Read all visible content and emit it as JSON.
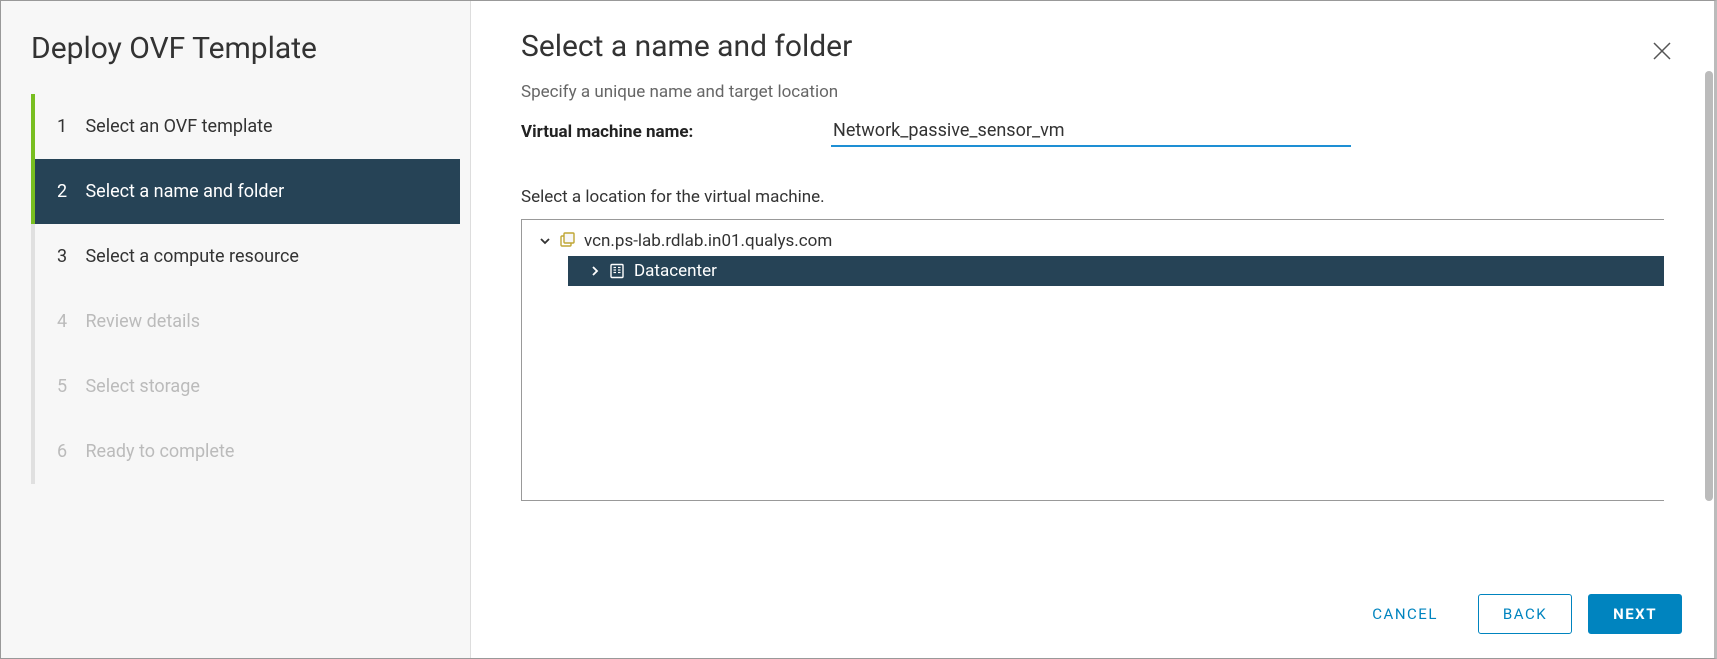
{
  "sidebar": {
    "title": "Deploy OVF Template",
    "steps": [
      {
        "num": "1",
        "label": "Select an OVF template"
      },
      {
        "num": "2",
        "label": "Select a name and folder"
      },
      {
        "num": "3",
        "label": "Select a compute resource"
      },
      {
        "num": "4",
        "label": "Review details"
      },
      {
        "num": "5",
        "label": "Select storage"
      },
      {
        "num": "6",
        "label": "Ready to complete"
      }
    ]
  },
  "main": {
    "title": "Select a name and folder",
    "subtitle": "Specify a unique name and target location",
    "vmname_label": "Virtual machine name:",
    "vmname_value": "Network_passive_sensor_vm",
    "location_label": "Select a location for the virtual machine.",
    "tree": {
      "root": "vcn.ps-lab.rdlab.in01.qualys.com",
      "children": [
        {
          "label": "Datacenter"
        }
      ]
    }
  },
  "footer": {
    "cancel": "CANCEL",
    "back": "BACK",
    "next": "NEXT"
  }
}
